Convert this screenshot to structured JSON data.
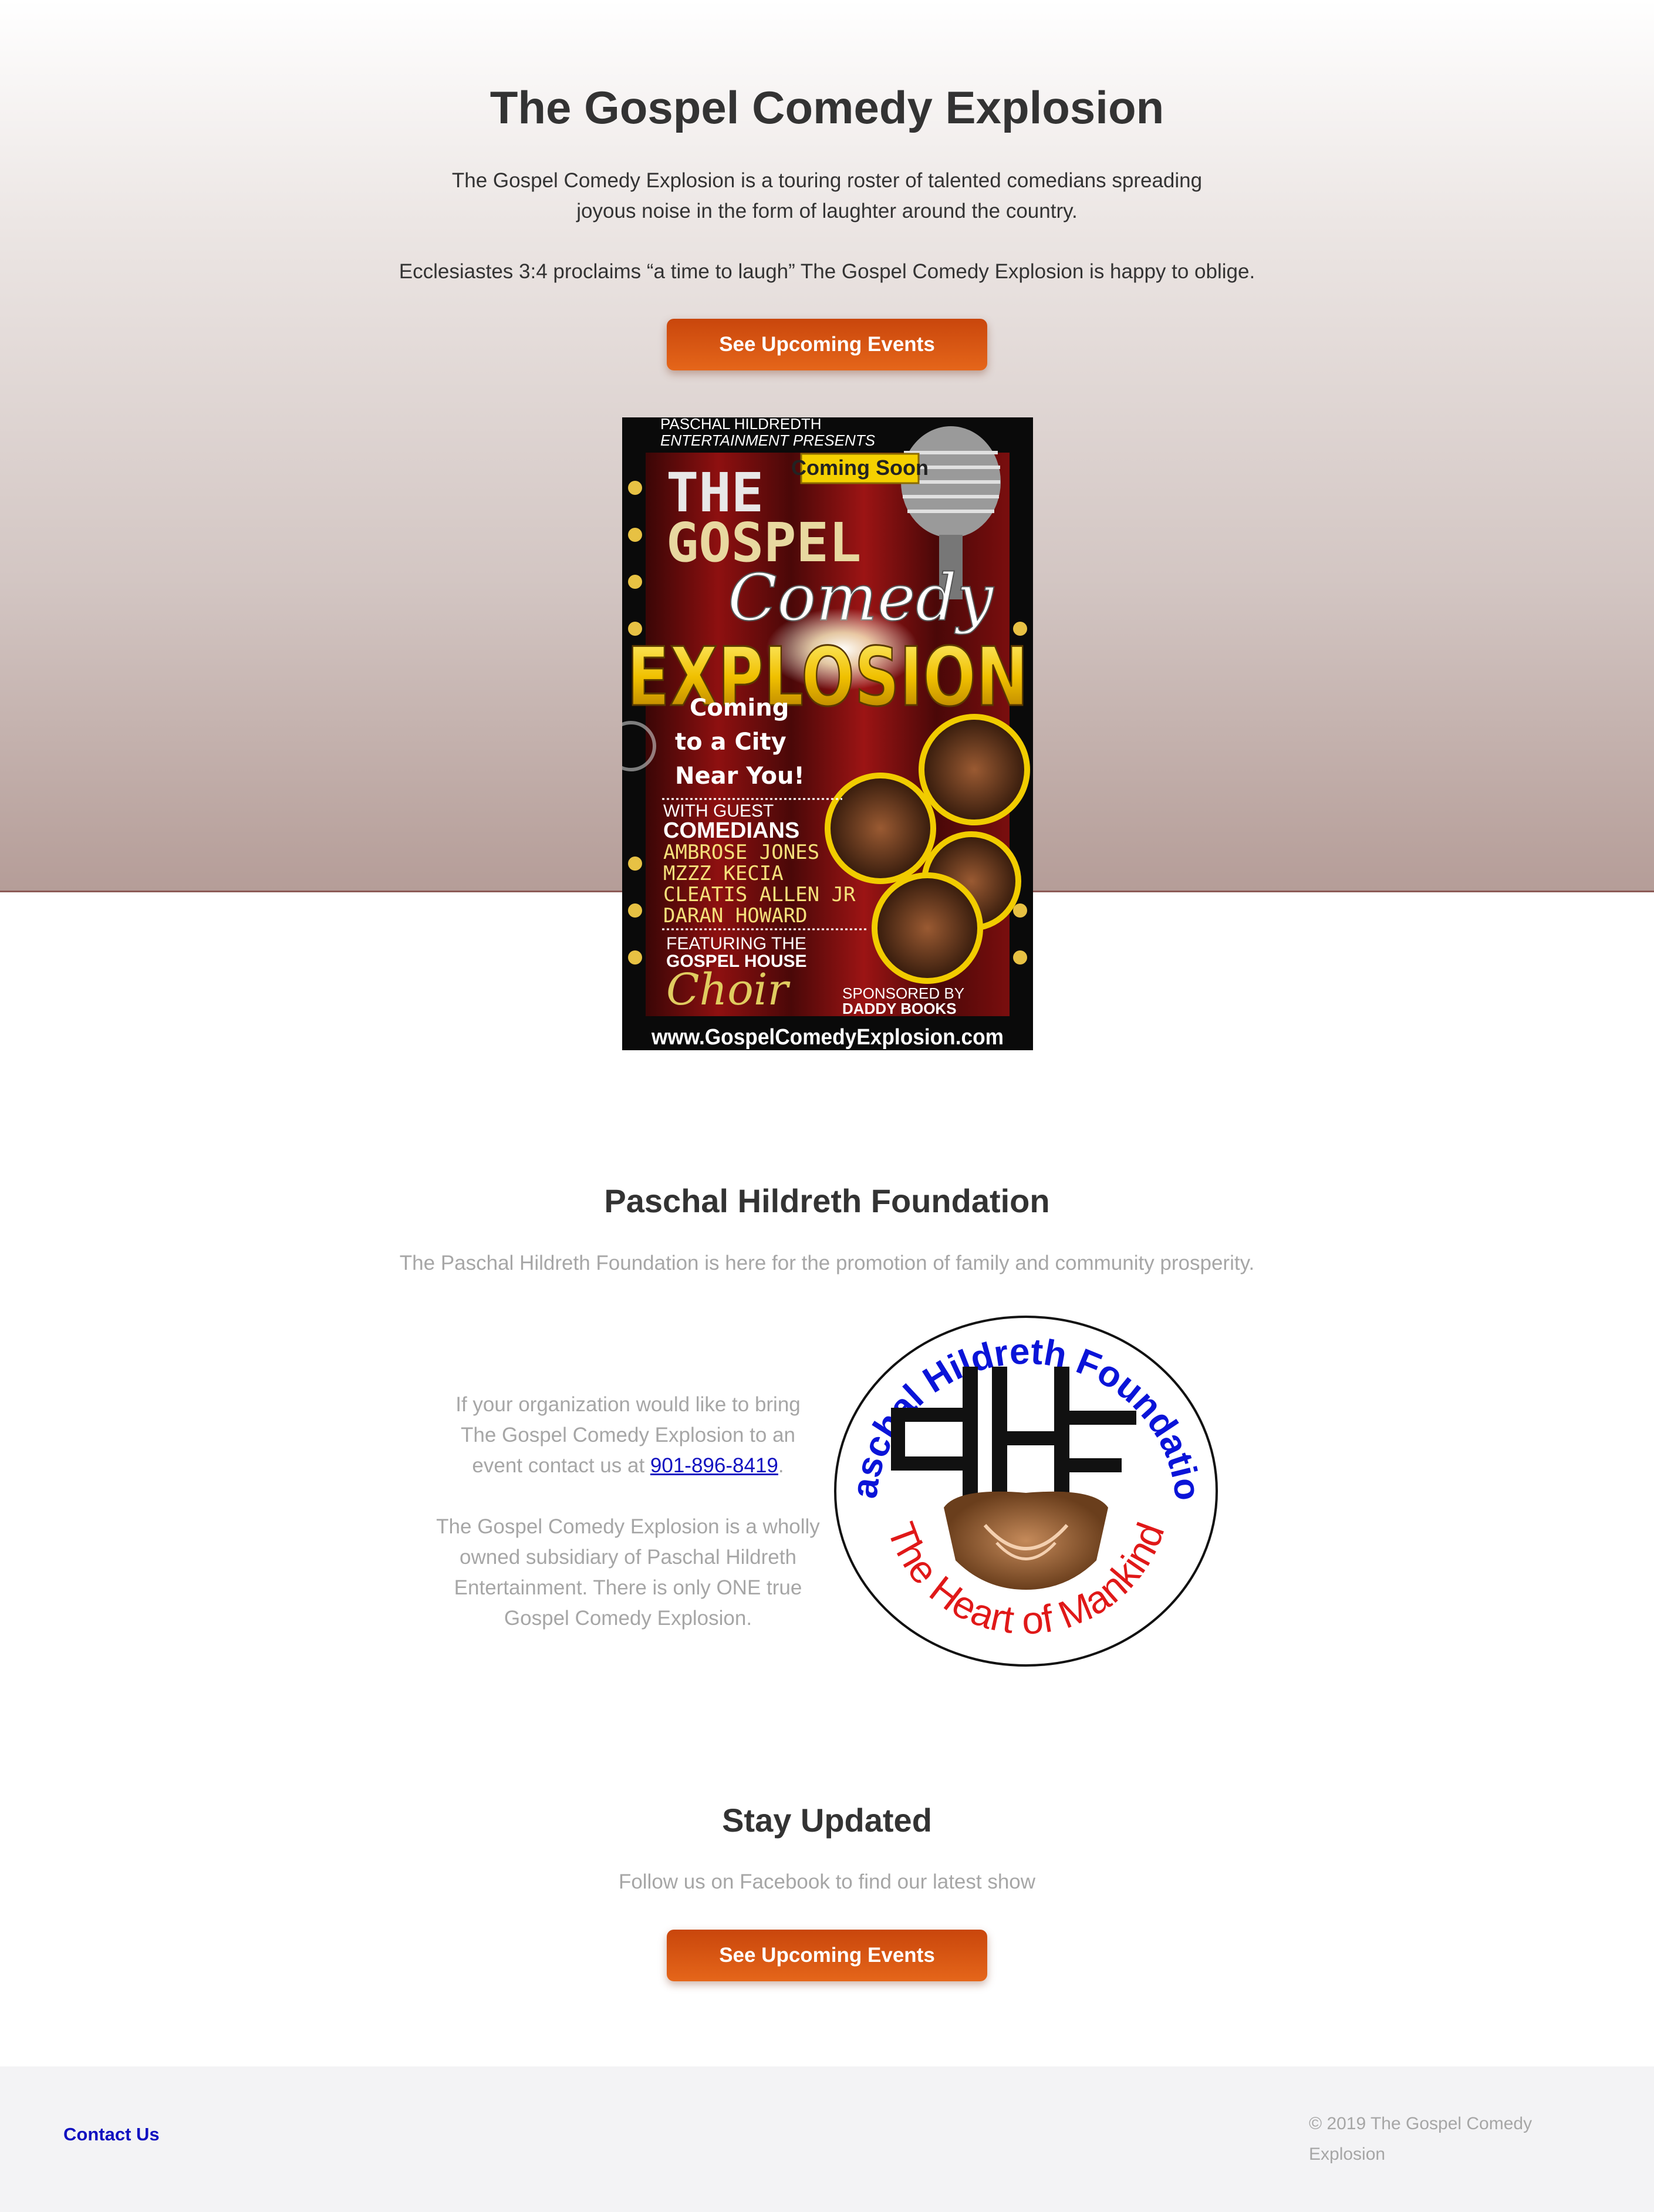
{
  "hero": {
    "title": "The Gospel Comedy Explosion",
    "paragraph1_line1": "The Gospel Comedy Explosion is a touring roster of talented comedians spreading",
    "paragraph1_line2": "joyous noise in the form of laughter around the country.",
    "paragraph2": "Ecclesiastes 3:4 proclaims “a time to laugh” The Gospel Comedy Explosion is happy to oblige.",
    "button_label": "See Upcoming Events"
  },
  "poster": {
    "presenter_line1": "PASCHAL HILDREDTH",
    "presenter_line2": "ENTERTAINMENT PRESENTS",
    "coming_soon": "Coming Soon",
    "title_the": "THE",
    "title_gospel": "GOSPEL",
    "title_comedy": "Comedy",
    "title_explosion": "EXPLOSION",
    "tagline1": "Coming",
    "tagline2": "to a City",
    "tagline3": "Near You!",
    "with_guest": "WITH GUEST",
    "comedians": "COMEDIANS",
    "names": [
      "AMBROSE JONES",
      "MZZZ KECIA",
      "CLEATIS ALLEN JR",
      "DARAN HOWARD"
    ],
    "featuring1": "FEATURING THE",
    "featuring2": "GOSPEL HOUSE",
    "choir": "Choir",
    "sponsored1": "SPONSORED BY",
    "sponsored2": "DADDY BOOKS",
    "website": "www.GospelComedyExplosion.com"
  },
  "foundation": {
    "title": "Paschal Hildreth Foundation",
    "subtitle": "The Paschal Hildreth Foundation is here for the promotion of family and community prosperity.",
    "contact_l1": "If your organization would like to bring",
    "contact_l2": "The Gospel Comedy Explosion to an",
    "contact_l3_prefix": "event contact us at ",
    "phone": "901-896-8419",
    "contact_l3_suffix": ".",
    "owned_l1": "The Gospel Comedy Explosion is a wholly",
    "owned_l2": "owned subsidiary of Paschal Hildreth",
    "owned_l3": "Entertainment. There is only ONE true",
    "owned_l4": "Gospel Comedy Explosion.",
    "logo_top_text": "Paschal Hildreth Foundation",
    "logo_bottom_text": "The Heart of Mankind",
    "logo_monogram": "PHF"
  },
  "updates": {
    "title": "Stay Updated",
    "subtitle": "Follow us on Facebook to find our latest show",
    "button_label": "See Upcoming Events"
  },
  "footer": {
    "contact_label": "Contact Us",
    "copyright_l1": "© 2019 The Gospel Comedy",
    "copyright_l2": "Explosion"
  },
  "colors": {
    "button": "#d4540f",
    "link": "#1010c0",
    "heading": "#333333",
    "muted": "#a6a6a6",
    "logo_blue": "#0a14d8",
    "logo_red": "#e01818"
  }
}
